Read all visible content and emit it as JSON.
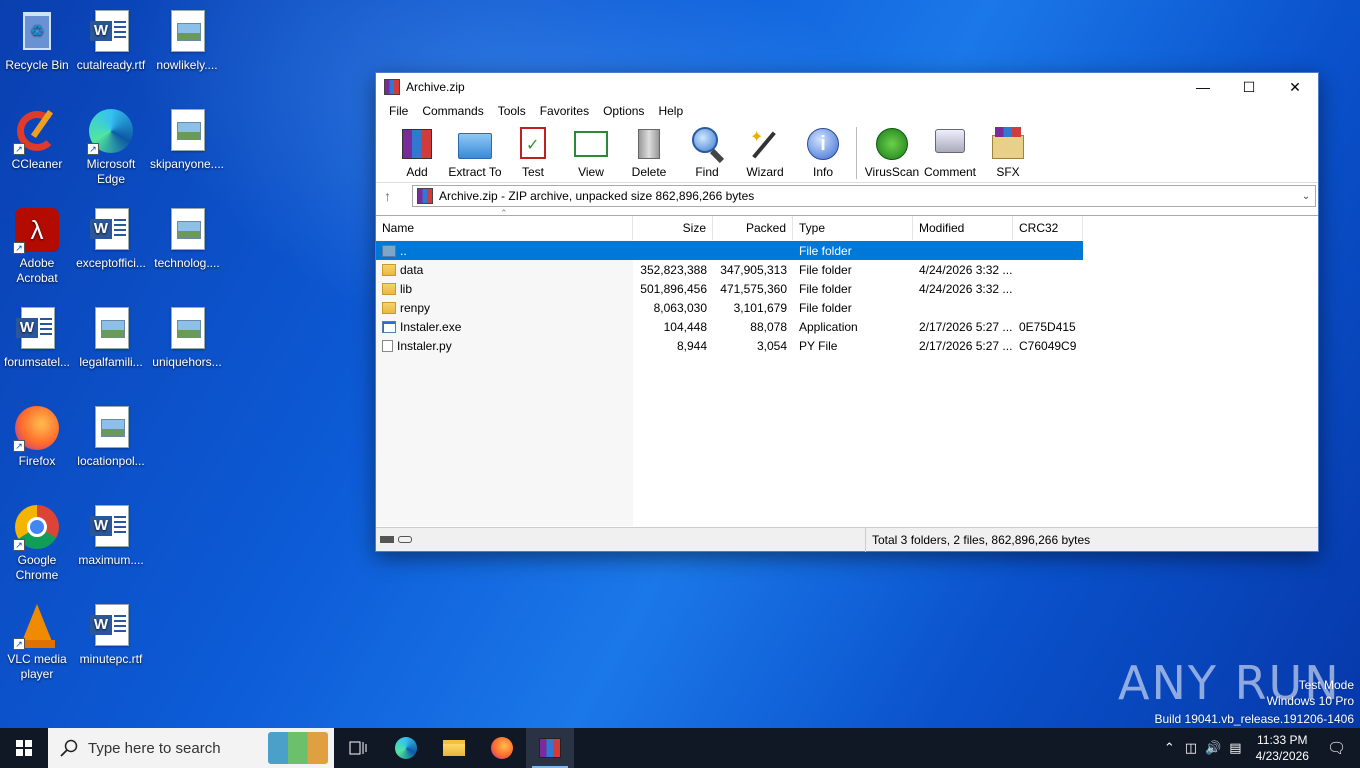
{
  "desktop": {
    "icons": [
      {
        "label": "Recycle Bin",
        "icon": "recycle-bin-icon"
      },
      {
        "label": "cutalready.rtf",
        "icon": "word-document-icon"
      },
      {
        "label": "nowlikely....",
        "icon": "image-file-icon"
      },
      {
        "label": "CCleaner",
        "icon": "ccleaner-icon"
      },
      {
        "label": "Microsoft Edge",
        "icon": "edge-icon"
      },
      {
        "label": "skipanyone....",
        "icon": "image-file-icon"
      },
      {
        "label": "Adobe Acrobat",
        "icon": "acrobat-icon"
      },
      {
        "label": "exceptoffici...",
        "icon": "word-document-icon"
      },
      {
        "label": "technolog....",
        "icon": "image-file-icon"
      },
      {
        "label": "forumsatel...",
        "icon": "word-document-icon"
      },
      {
        "label": "legalfamili...",
        "icon": "image-file-icon"
      },
      {
        "label": "uniquehors...",
        "icon": "image-file-icon"
      },
      {
        "label": "Firefox",
        "icon": "firefox-icon"
      },
      {
        "label": "locationpol...",
        "icon": "image-file-icon"
      },
      {
        "label": "Google Chrome",
        "icon": "chrome-icon"
      },
      {
        "label": "maximum....",
        "icon": "word-document-icon"
      },
      {
        "label": "VLC media player",
        "icon": "vlc-icon"
      },
      {
        "label": "minutepc.rtf",
        "icon": "word-document-icon"
      }
    ]
  },
  "window": {
    "title": "Archive.zip",
    "menu": [
      "File",
      "Commands",
      "Tools",
      "Favorites",
      "Options",
      "Help"
    ],
    "toolbar": [
      {
        "label": "Add",
        "icon": "add-icon"
      },
      {
        "label": "Extract To",
        "icon": "extract-icon"
      },
      {
        "label": "Test",
        "icon": "test-icon"
      },
      {
        "label": "View",
        "icon": "view-icon"
      },
      {
        "label": "Delete",
        "icon": "delete-icon"
      },
      {
        "label": "Find",
        "icon": "find-icon"
      },
      {
        "label": "Wizard",
        "icon": "wizard-icon"
      },
      {
        "label": "Info",
        "icon": "info-icon"
      },
      {
        "label": "VirusScan",
        "icon": "virusscan-icon"
      },
      {
        "label": "Comment",
        "icon": "comment-icon"
      },
      {
        "label": "SFX",
        "icon": "sfx-icon"
      }
    ],
    "address": "Archive.zip - ZIP archive, unpacked size 862,896,266 bytes",
    "columns": [
      "Name",
      "Size",
      "Packed",
      "Type",
      "Modified",
      "CRC32"
    ],
    "rows": [
      {
        "name": "..",
        "size": "",
        "packed": "",
        "type": "File folder",
        "modified": "",
        "crc": "",
        "icon": "up-folder-icon",
        "selected": true
      },
      {
        "name": "data",
        "size": "352,823,388",
        "packed": "347,905,313",
        "type": "File folder",
        "modified": "4/24/2026 3:32 ...",
        "crc": "",
        "icon": "folder-icon"
      },
      {
        "name": "lib",
        "size": "501,896,456",
        "packed": "471,575,360",
        "type": "File folder",
        "modified": "4/24/2026 3:32 ...",
        "crc": "",
        "icon": "folder-icon"
      },
      {
        "name": "renpy",
        "size": "8,063,030",
        "packed": "3,101,679",
        "type": "File folder",
        "modified": "",
        "crc": "",
        "icon": "folder-icon"
      },
      {
        "name": "Instaler.exe",
        "size": "104,448",
        "packed": "88,078",
        "type": "Application",
        "modified": "2/17/2026 5:27 ...",
        "crc": "0E75D415",
        "icon": "exe-icon"
      },
      {
        "name": "Instaler.py",
        "size": "8,944",
        "packed": "3,054",
        "type": "PY File",
        "modified": "2/17/2026 5:27 ...",
        "crc": "C76049C9",
        "icon": "file-icon"
      }
    ],
    "status": "Total 3 folders, 2 files, 862,896,266 bytes"
  },
  "watermark": {
    "brand": "ANY RUN",
    "line1": "Test Mode",
    "line2": "Windows 10 Pro",
    "line3": "Build 19041.vb_release.191206-1406"
  },
  "taskbar": {
    "search_placeholder": "Type here to search",
    "time": "11:33 PM",
    "date": "4/23/2026"
  }
}
